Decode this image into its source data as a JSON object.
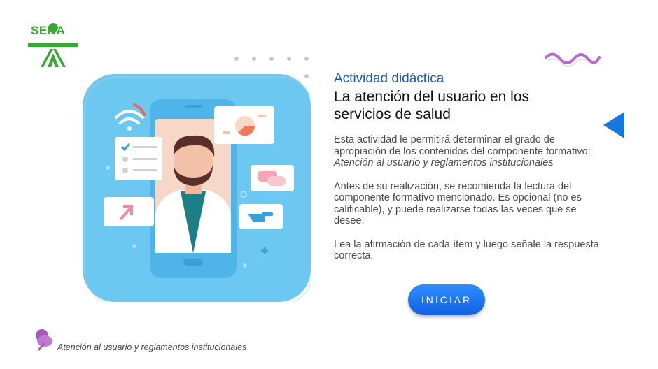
{
  "logo": {
    "text": "SENA"
  },
  "activity": {
    "label": "Actividad didáctica",
    "title_line1": "La atención del usuario en los",
    "title_line2": "servicios de salud"
  },
  "paragraphs": {
    "p1_text": "Esta actividad le permitirá determinar el grado de apropiación de los contenidos del componente formativo: ",
    "p1_emphasis": "Atención al usuario y reglamentos institucionales",
    "p2": "Antes de su realización, se recomienda la lectura del componente formativo mencionado. Es opcional (no es calificable), y puede realizarse todas las veces que se desee.",
    "p3": "Lea la afirmación de cada ítem y luego señale la respuesta correcta."
  },
  "start_button": {
    "label": "INICIAR"
  },
  "footer": {
    "text": "Atención al usuario y reglamentos institucionales"
  },
  "icons": {
    "logo": "sena-logo-icon",
    "nav": "triangle-left-icon",
    "pin": "pushpin-icon",
    "wave": "wave-decoration-icon",
    "dots": "dot-grid-decoration-icon"
  },
  "colors": {
    "brand_green": "#39a935",
    "title_blue": "#1f5aa6",
    "button_blue": "#1a73e8",
    "nav_blue": "#1677e0",
    "wave_purple": "#b56cc9",
    "illustration_bg": "#6cc8f0"
  }
}
